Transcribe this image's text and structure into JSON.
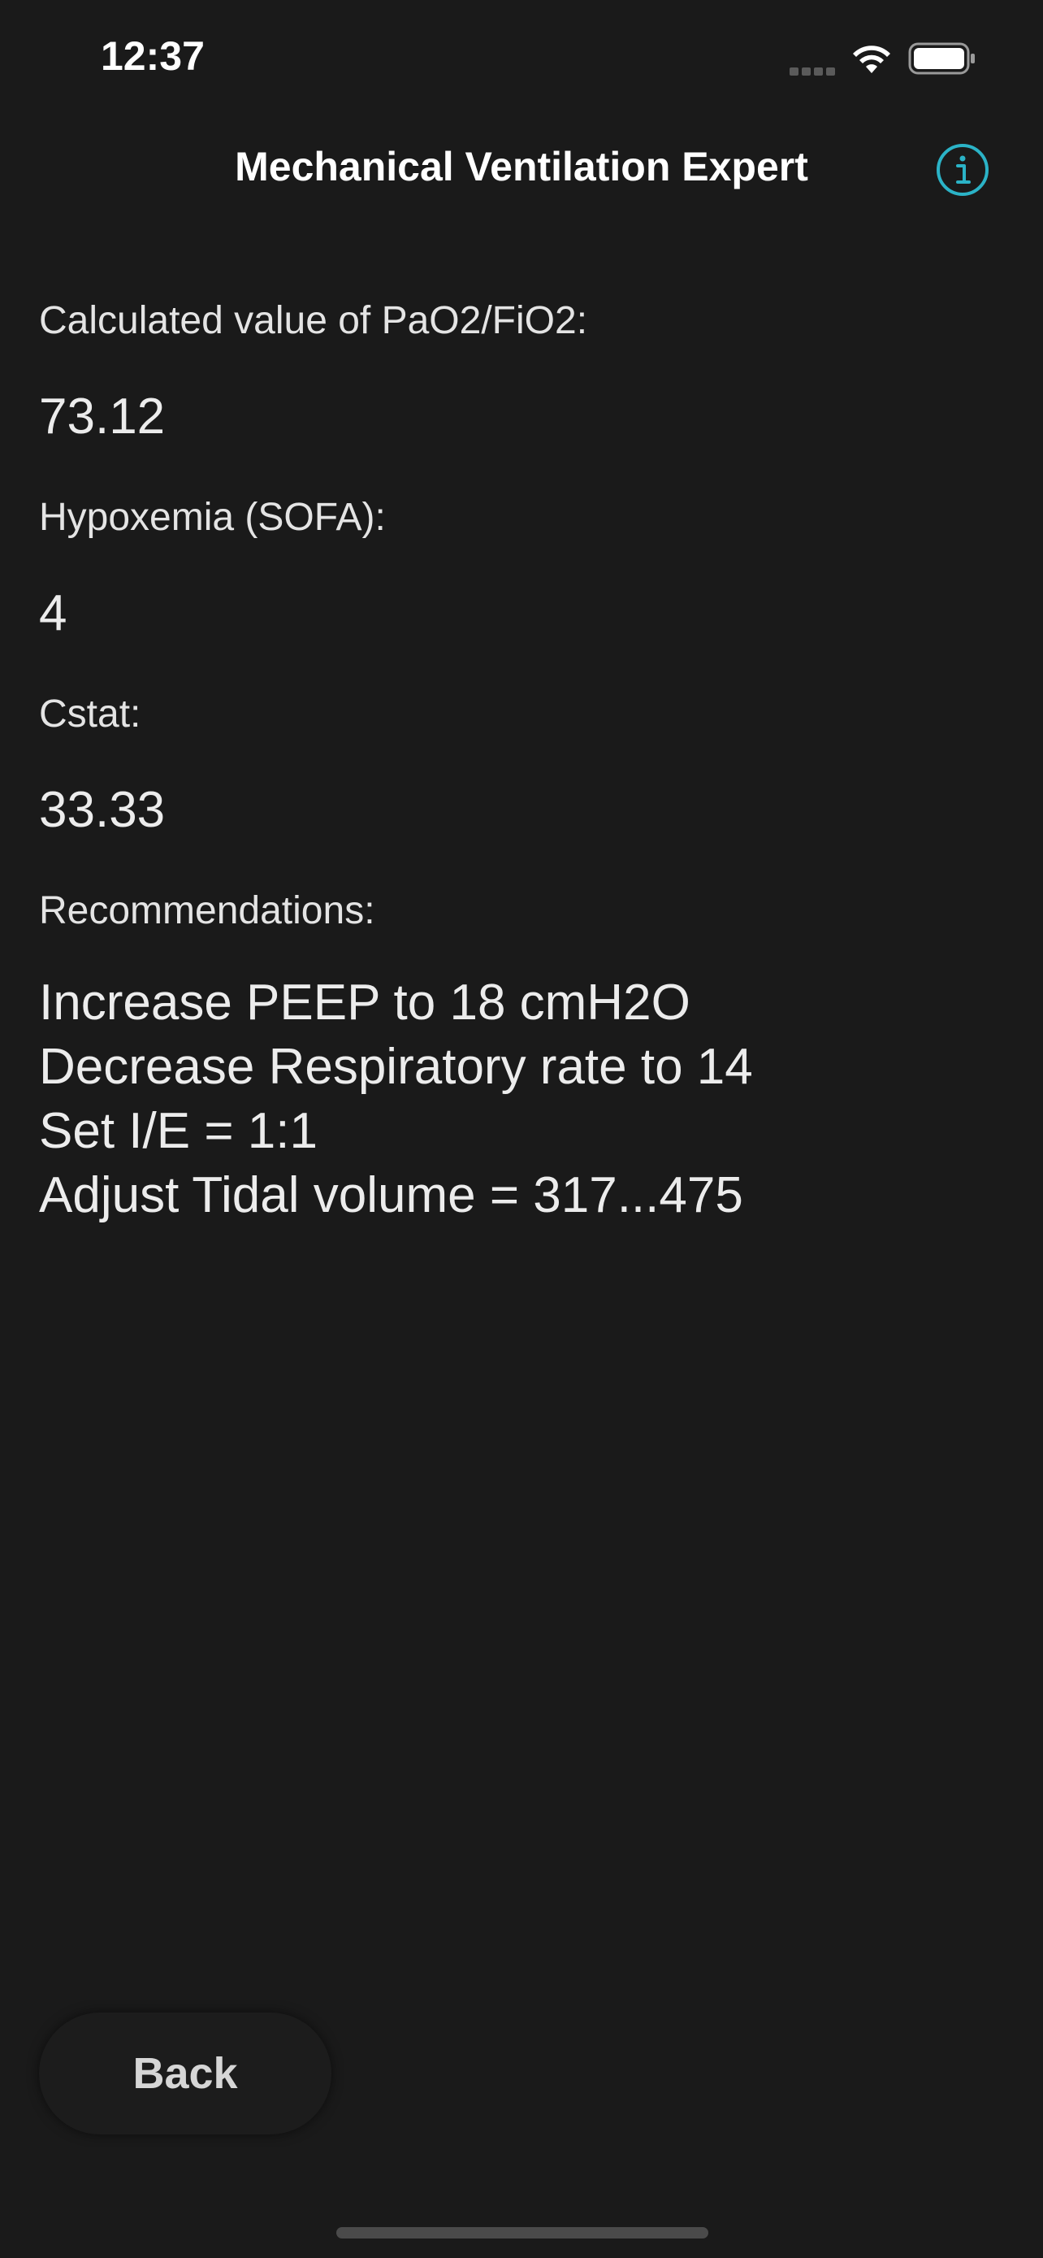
{
  "status_bar": {
    "time": "12:37",
    "icons": [
      "cellular-signal-icon",
      "wifi-icon",
      "battery-icon"
    ]
  },
  "nav_bar": {
    "title": "Mechanical Ventilation Expert",
    "info_icon": "info-icon",
    "accent_color": "#2bb3c7"
  },
  "results": {
    "pao2_fio2_label": "Calculated value of PaO2/FiO2:",
    "pao2_fio2_value": "73.12",
    "hypoxemia_label": "Hypoxemia (SOFA):",
    "hypoxemia_value": "4",
    "cstat_label": "Cstat:",
    "cstat_value": "33.33",
    "recommendations_label": "Recommendations:",
    "recommendations": [
      "Increase PEEP to 18 cmH2O",
      "Decrease Respiratory rate to 14",
      "Set I/E = 1:1",
      "Adjust Tidal volume = 317...475"
    ]
  },
  "footer": {
    "back_label": "Back"
  },
  "colors": {
    "background": "#1a1a1a",
    "text": "#e8e8e8"
  }
}
